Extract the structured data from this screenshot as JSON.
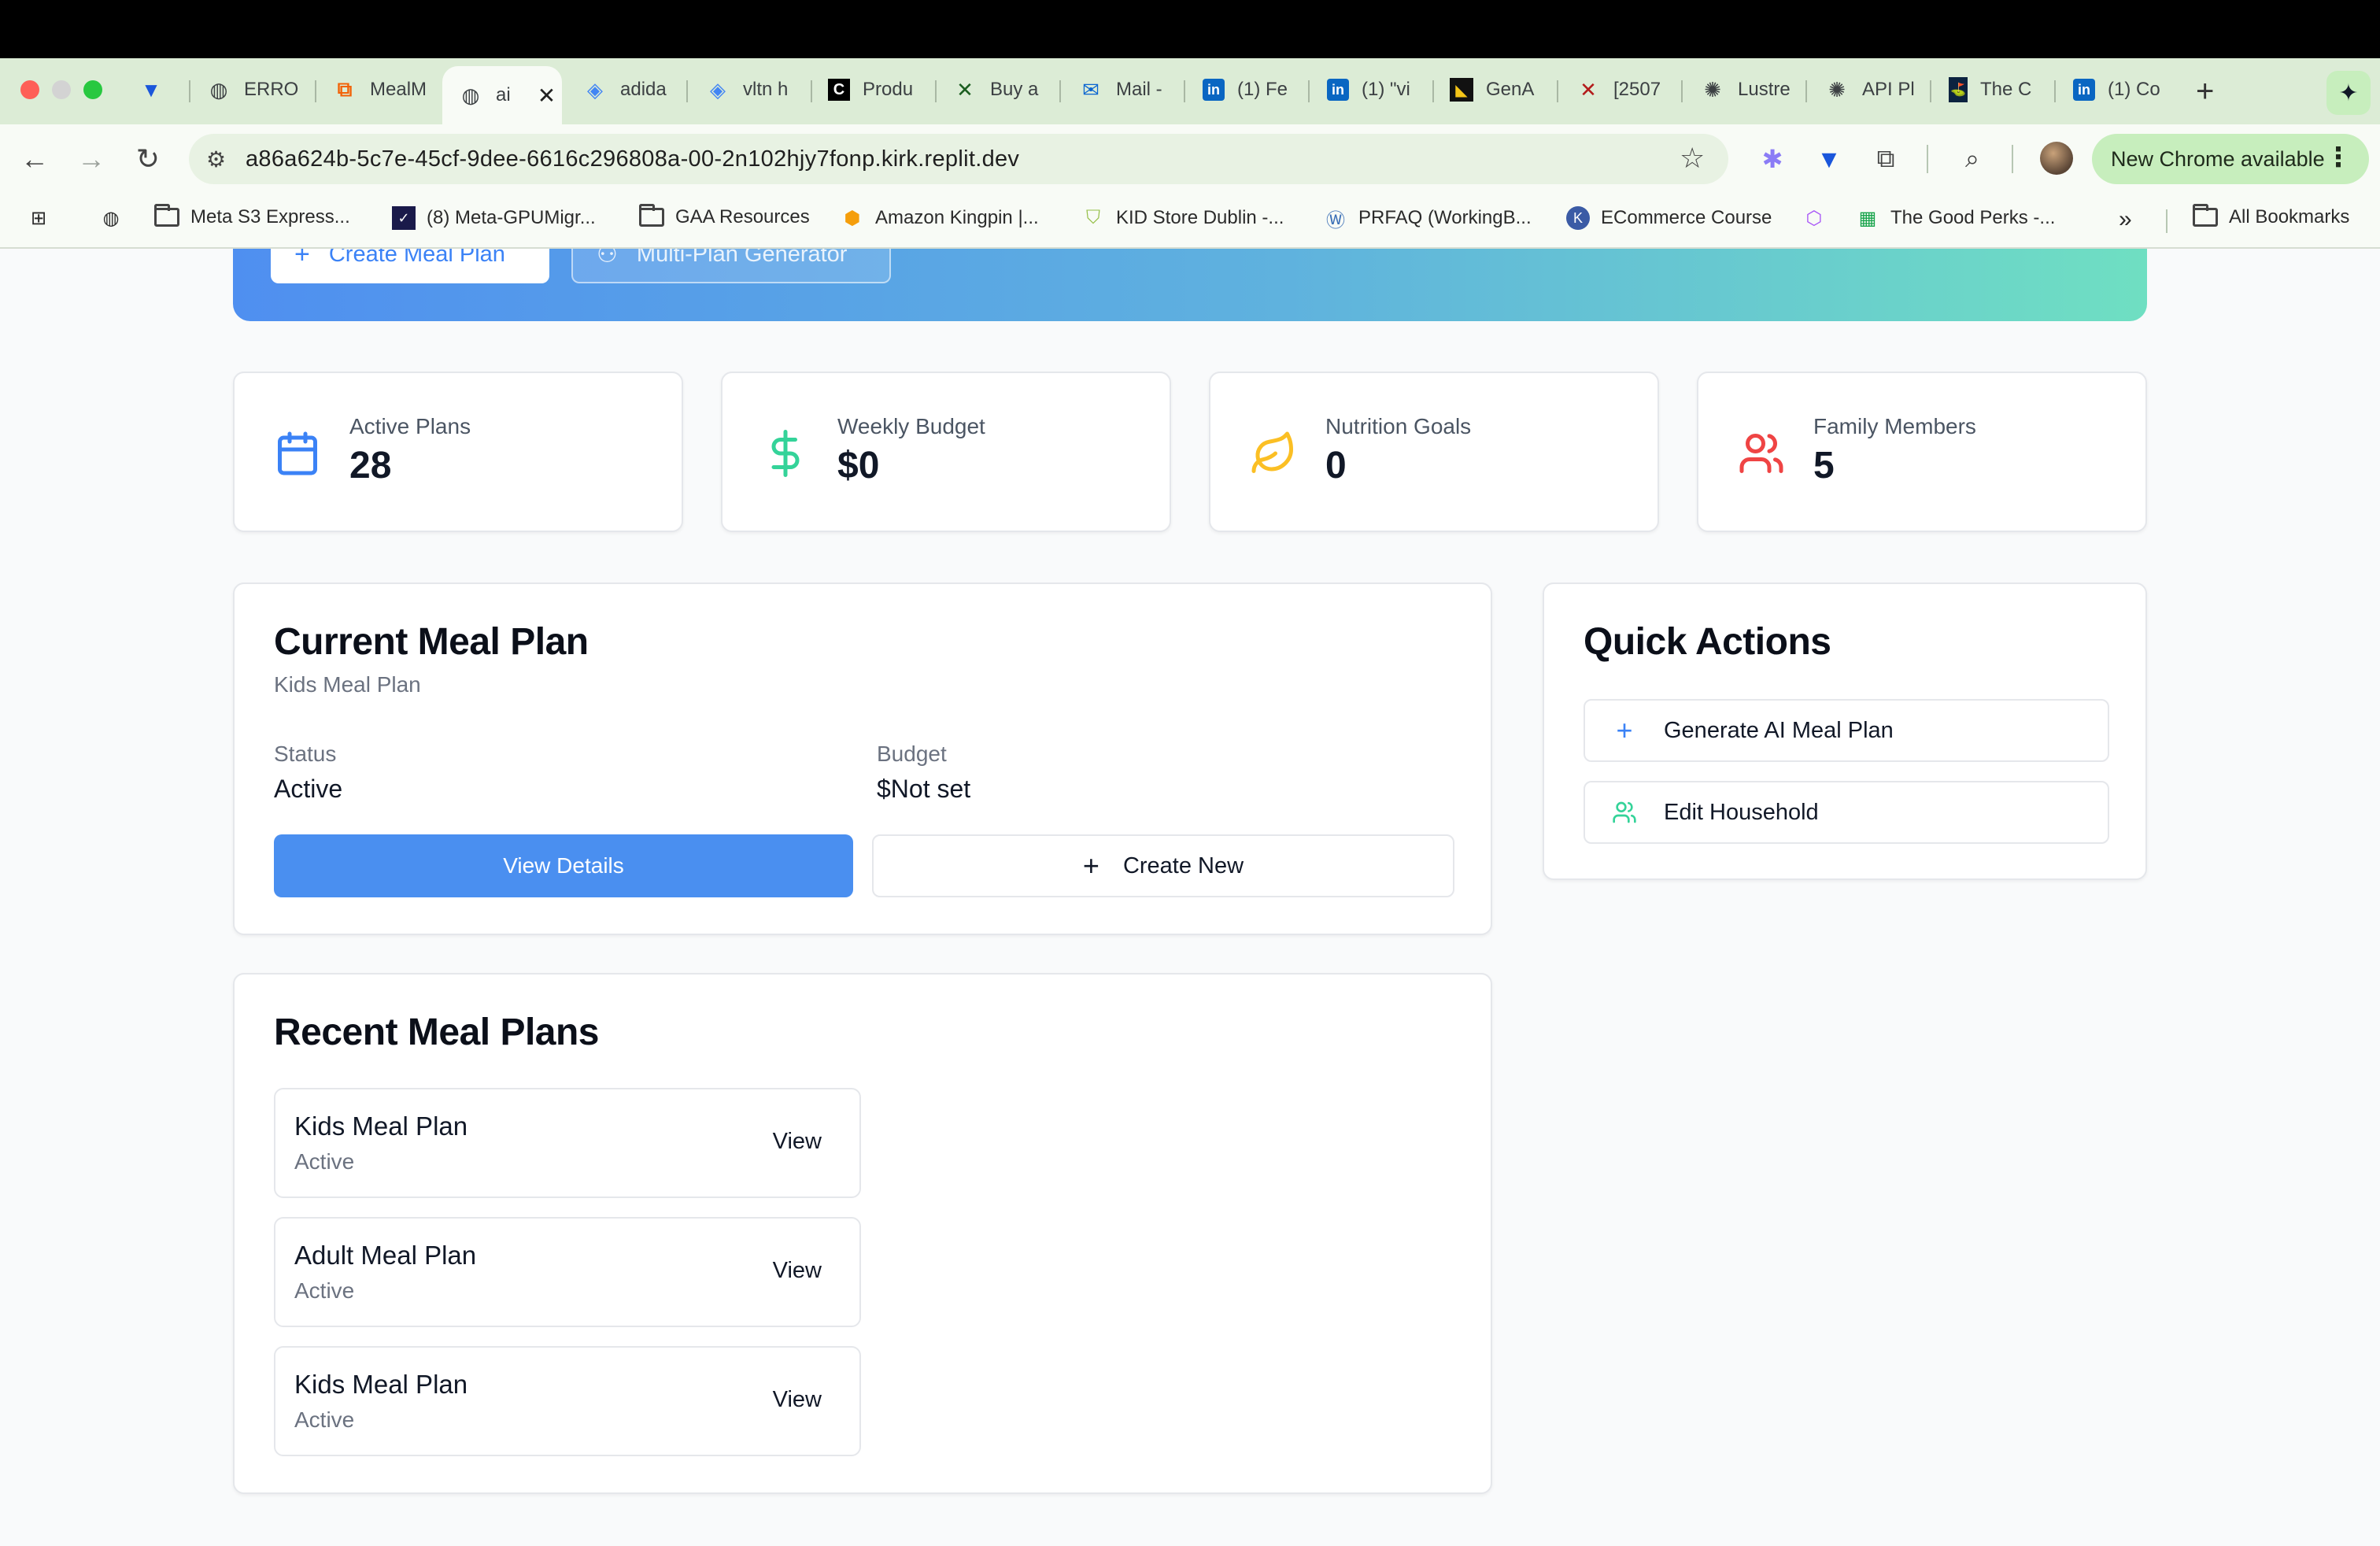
{
  "browser": {
    "tabs": [
      {
        "label": "",
        "icon": "vpn-icon"
      },
      {
        "label": "ERRO",
        "icon": "globe-icon"
      },
      {
        "label": "MealM",
        "icon": "replit-icon"
      },
      {
        "label": "ai",
        "icon": "globe-icon",
        "active": true
      },
      {
        "label": "adida",
        "icon": "shopping-bag-icon"
      },
      {
        "label": "vltn h",
        "icon": "shopping-bag-icon"
      },
      {
        "label": "Produ",
        "icon": "c-logo-icon"
      },
      {
        "label": "Buy a",
        "icon": "x-logo-icon"
      },
      {
        "label": "Mail -",
        "icon": "outlook-icon"
      },
      {
        "label": "(1) Fe",
        "icon": "linkedin-icon"
      },
      {
        "label": "(1) \"vi",
        "icon": "linkedin-icon"
      },
      {
        "label": "GenA",
        "icon": "gena-icon"
      },
      {
        "label": "[2507",
        "icon": "arxiv-icon"
      },
      {
        "label": "Lustre",
        "icon": "openai-icon"
      },
      {
        "label": "API Pl",
        "icon": "openai-icon"
      },
      {
        "label": "The C",
        "icon": "pga-icon"
      },
      {
        "label": "(1) Co",
        "icon": "linkedin-icon"
      }
    ],
    "url": "a86a624b-5c7e-45cf-9dee-6616c296808a-00-2n102hjy7fonp.kirk.replit.dev",
    "update_label": "New Chrome available",
    "bookmarks": [
      {
        "label": "Meta S3 Express...",
        "icon": "folder-icon"
      },
      {
        "label": "(8) Meta-GPUMigr...",
        "icon": "meta-icon"
      },
      {
        "label": "GAA Resources",
        "icon": "folder-icon"
      },
      {
        "label": "Amazon Kingpin |...",
        "icon": "kingpin-icon"
      },
      {
        "label": "KID Store Dublin -...",
        "icon": "shopify-icon"
      },
      {
        "label": "PRFAQ (WorkingB...",
        "icon": "wiki-icon"
      },
      {
        "label": "ECommerce Course",
        "icon": "k-icon"
      },
      {
        "label": "",
        "icon": "cube-icon"
      },
      {
        "label": "The Good Perks -...",
        "icon": "sheets-icon"
      }
    ],
    "overflow_label": "»",
    "all_bookmarks_label": "All Bookmarks"
  },
  "hero": {
    "create_label": "Create Meal Plan",
    "multi_label": "Multi-Plan Generator"
  },
  "stats": [
    {
      "label": "Active Plans",
      "value": "28",
      "icon": "calendar-icon",
      "color": "#3b82f6"
    },
    {
      "label": "Weekly Budget",
      "value": "$0",
      "icon": "dollar-icon",
      "color": "#34d399"
    },
    {
      "label": "Nutrition Goals",
      "value": "0",
      "icon": "leaf-icon",
      "color": "#fbbf24"
    },
    {
      "label": "Family Members",
      "value": "5",
      "icon": "users-icon",
      "color": "#ef4444"
    }
  ],
  "current_plan": {
    "title": "Current Meal Plan",
    "subtitle": "Kids Meal Plan",
    "status_label": "Status",
    "status_value": "Active",
    "budget_label": "Budget",
    "budget_value": "$Not set",
    "view_details_label": "View Details",
    "create_new_label": "Create New"
  },
  "quick_actions": {
    "title": "Quick Actions",
    "items": [
      {
        "label": "Generate AI Meal Plan",
        "icon": "plus-icon"
      },
      {
        "label": "Edit Household",
        "icon": "users-icon"
      }
    ]
  },
  "recent": {
    "title": "Recent Meal Plans",
    "plans": [
      {
        "name": "Kids Meal Plan",
        "status": "Active",
        "action": "View"
      },
      {
        "name": "Adult Meal Plan",
        "status": "Active",
        "action": "View"
      },
      {
        "name": "Kids Meal Plan",
        "status": "Active",
        "action": "View"
      }
    ]
  },
  "colors": {
    "primary": "#4a8ff0",
    "gradient_start": "#4f8ff0",
    "gradient_end": "#6fdfc2"
  }
}
